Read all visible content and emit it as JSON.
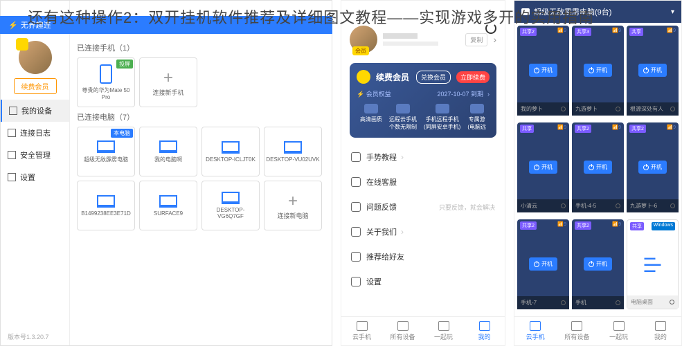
{
  "title": "还有这种操作2：双开挂机软件推荐及详细图文教程——实现游戏多开的实用指南",
  "left": {
    "header": "无界趣连",
    "member_btn": "续费会员",
    "sidebar": [
      {
        "label": "我的设备"
      },
      {
        "label": "连接日志"
      },
      {
        "label": "安全管理"
      },
      {
        "label": "设置"
      }
    ],
    "version": "版本号1.3.20.7",
    "phones_label": "已连接手机（1）",
    "phones": [
      {
        "name": "尊贵的华为Mate 50 Pro",
        "tag": "投屏"
      },
      {
        "name": "连接新手机",
        "add": true
      }
    ],
    "pcs_label": "已连接电脑（7）",
    "pcs": [
      {
        "name": "超级无敌霹雳电脑",
        "tag": "本电脑"
      },
      {
        "name": "我的电脑啊"
      },
      {
        "name": "DESKTOP-ICLJT0K"
      },
      {
        "name": "DESKTOP-VU02UVK"
      },
      {
        "name": "B1499238EE3E71D"
      },
      {
        "name": "SURFACE9"
      },
      {
        "name": "DESKTOP-VG6Q7GF"
      },
      {
        "name": "连接新电脑",
        "add": true
      }
    ]
  },
  "mid": {
    "member_tag": "会员",
    "copy": "复制",
    "member_title": "续费会员",
    "exchange": "兑换会员",
    "renew": "立即续费",
    "rights": "会员权益",
    "expire": "2027-10-07 到期",
    "features": [
      "高清画质",
      "远程云手机\n个数无限制",
      "手机远程手机\n(同屏安卓手机)",
      "专属游\n(电脑远"
    ],
    "menu": [
      {
        "label": "手势教程",
        "sub": "",
        "arr": true
      },
      {
        "label": "在线客服",
        "sub": ""
      },
      {
        "label": "问题反馈",
        "sub": "只要反馈，就会解决"
      },
      {
        "label": "关于我们",
        "sub": "",
        "arr": true
      },
      {
        "label": "推荐给好友",
        "sub": ""
      },
      {
        "label": "设置",
        "sub": ""
      }
    ],
    "nav": [
      "云手机",
      "所有设备",
      "一起玩",
      "我的"
    ]
  },
  "right": {
    "header": "超级无敌霹雳电脑(9台)",
    "power": "开机",
    "tags": {
      "share": "共享",
      "signal": "📶"
    },
    "cards": [
      {
        "name": "我的萝卜",
        "share": "共享2"
      },
      {
        "name": "九游萝卜",
        "share": "共享3"
      },
      {
        "name": "根源深处有人",
        "share": ""
      },
      {
        "name": "小清云",
        "share": ""
      },
      {
        "name": "手机-4-5",
        "share": "共享2"
      },
      {
        "name": "九游萝卜-6",
        "share": "共享2"
      },
      {
        "name": "手机-7",
        "share": "共享2"
      },
      {
        "name": "手机",
        "share": "共享2"
      },
      {
        "name": "电脑桌面",
        "share": "",
        "win": "Windows",
        "white": true
      }
    ],
    "nav": [
      "云手机",
      "所有设备",
      "一起玩",
      "我的"
    ]
  }
}
